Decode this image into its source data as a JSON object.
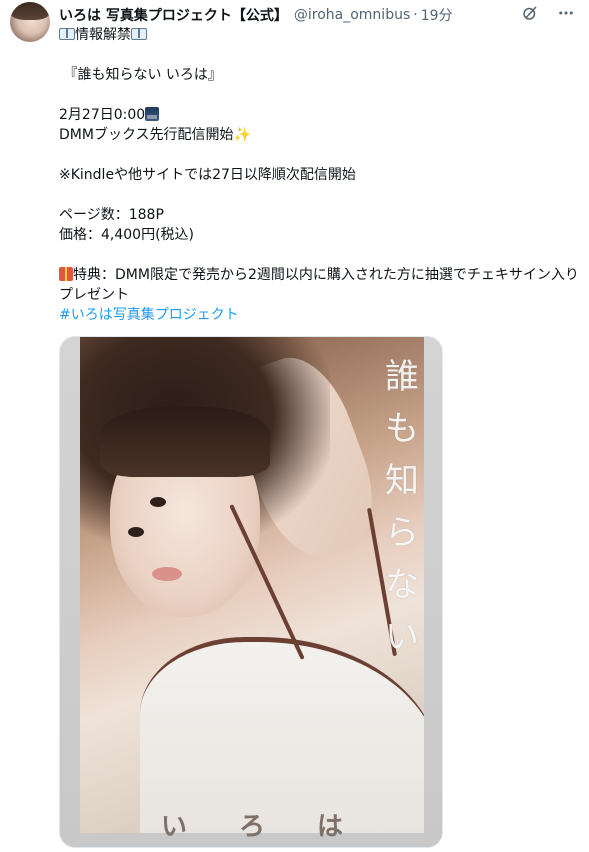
{
  "header": {
    "display_name": "いろは 写真集プロジェクト【公式】",
    "handle": "@iroha_omnibus",
    "separator": "·",
    "time": "19分"
  },
  "icons": [
    "avatar",
    "grok-icon",
    "more-icon",
    "book-emoji",
    "night-emoji",
    "sparkle-emoji",
    "gift-emoji"
  ],
  "body": {
    "line1": "情報解禁",
    "line2": "『誰も知らない いろは』",
    "line3": "2月27日0:00",
    "line4": "DMMブックス先行配信開始",
    "line5": "※Kindleや他サイトでは27日以降順次配信開始",
    "line6": "ページ数：188P",
    "line7": "価格：4,400円(税込)",
    "line8": "特典：DMM限定で発売から2週間以内に購入された方に抽選でチェキサイン入りプレゼント",
    "hashtag": "#いろは写真集プロジェクト"
  },
  "media": {
    "cover_title_chars": [
      "誰",
      "も",
      "知",
      "ら",
      "な",
      "い"
    ],
    "cover_author_chars": [
      "い",
      "ろ",
      "は"
    ]
  }
}
